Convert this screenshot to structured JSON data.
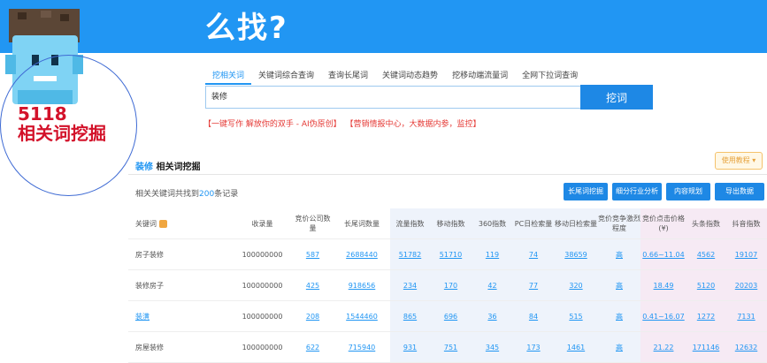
{
  "banner": {
    "title": "么找?"
  },
  "tabs": [
    "挖相关词",
    "关键词综合查询",
    "查询长尾词",
    "关键词动态趋势",
    "挖移动端流量词",
    "全网下拉词查询"
  ],
  "search": {
    "value": "装修",
    "button": "挖词"
  },
  "promo": [
    "【一键写作 解放你的双手 - AI伪原创】",
    "【营销情报中心，大数据内参，监控】"
  ],
  "section": {
    "keyword": "装修",
    "title": "相关词挖掘"
  },
  "tutorial_label": "使用教程 ▾",
  "result": {
    "prefix": "相关关键词共找到",
    "count": "200",
    "suffix": "条记录"
  },
  "actions": {
    "longtail": "长尾词挖掘",
    "industry": "细分行业分析",
    "plan": "内容规划",
    "export": "导出数据"
  },
  "table": {
    "headers": [
      "关键词",
      "收录量",
      "竞价公司数量",
      "长尾词数量",
      "流量指数",
      "移动指数",
      "360指数",
      "PC日检索量",
      "移动日检索量",
      "竞价竞争激烈程度",
      "竞价点击价格(¥)",
      "头条指数",
      "抖音指数"
    ],
    "rows": [
      [
        "房子装修",
        "100000000",
        "587",
        "2688440",
        "51782",
        "51710",
        "119",
        "74",
        "38659",
        "高",
        "0.66~11.04",
        "4562",
        "19107"
      ],
      [
        "装修房子",
        "100000000",
        "425",
        "918656",
        "234",
        "170",
        "42",
        "77",
        "320",
        "高",
        "18.49",
        "5120",
        "20203"
      ],
      [
        "装潢",
        "100000000",
        "208",
        "1544460",
        "865",
        "696",
        "36",
        "84",
        "515",
        "高",
        "0.41~16.07",
        "1272",
        "7131"
      ],
      [
        "房屋装修",
        "100000000",
        "622",
        "715940",
        "931",
        "751",
        "345",
        "173",
        "1461",
        "高",
        "21.22",
        "171146",
        "12632"
      ]
    ]
  },
  "watermark": {
    "line1": "5118",
    "line2": "相关词挖掘"
  }
}
